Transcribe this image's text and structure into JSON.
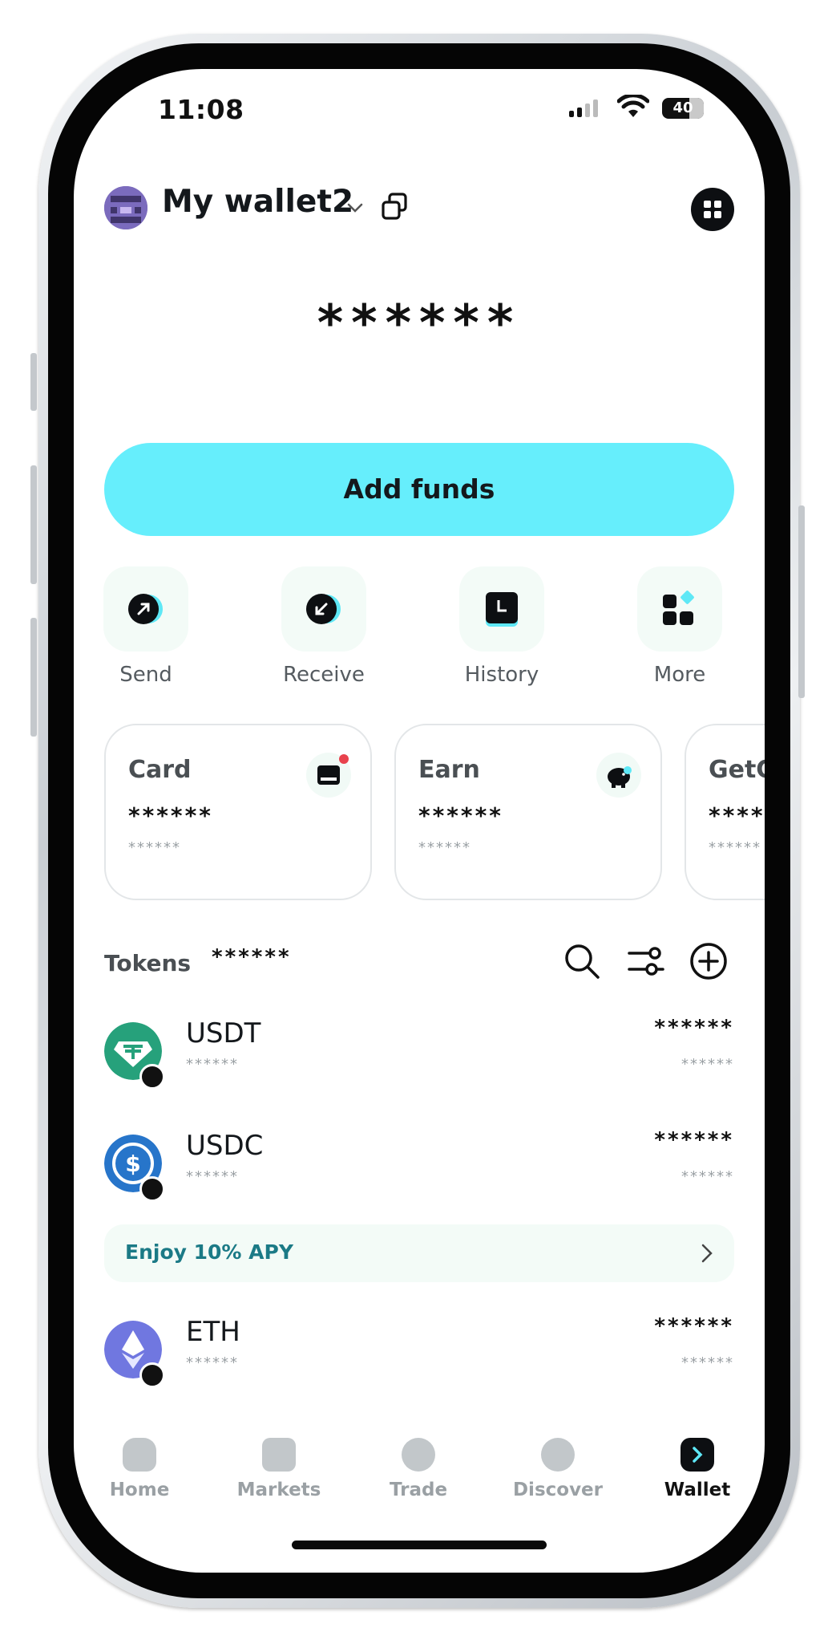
{
  "status_bar": {
    "time": "11:08",
    "battery": "40"
  },
  "header": {
    "wallet_name": "My wallet2"
  },
  "balance": "******",
  "add_funds_label": "Add funds",
  "quick_actions": [
    {
      "label": "Send",
      "icon": "send-arrow-icon"
    },
    {
      "label": "Receive",
      "icon": "receive-arrow-icon"
    },
    {
      "label": "History",
      "icon": "history-clock-icon"
    },
    {
      "label": "More",
      "icon": "more-apps-icon"
    }
  ],
  "cards": [
    {
      "title": "Card",
      "value": "******",
      "sub": "******",
      "icon": "card-icon"
    },
    {
      "title": "Earn",
      "value": "******",
      "sub": "******",
      "icon": "piggy-bank-icon"
    },
    {
      "title": "GetGo",
      "value": "******",
      "sub": "******",
      "icon": "getgo-icon"
    }
  ],
  "tokens_header": {
    "label": "Tokens",
    "total": "******"
  },
  "tokens": [
    {
      "symbol": "USDT",
      "sub": "******",
      "value": "******",
      "value_sub": "******",
      "color": "#26a17b"
    },
    {
      "symbol": "USDC",
      "sub": "******",
      "value": "******",
      "value_sub": "******",
      "color": "#2775ca"
    },
    {
      "symbol": "ETH",
      "sub": "******",
      "value": "******",
      "value_sub": "******",
      "color": "#7077e0"
    }
  ],
  "apy_banner": "Enjoy 10% APY",
  "bottom_nav": [
    {
      "label": "Home",
      "icon": "home-icon",
      "active": false
    },
    {
      "label": "Markets",
      "icon": "markets-icon",
      "active": false
    },
    {
      "label": "Trade",
      "icon": "trade-icon",
      "active": false
    },
    {
      "label": "Discover",
      "icon": "discover-icon",
      "active": false
    },
    {
      "label": "Wallet",
      "icon": "wallet-icon",
      "active": true
    }
  ],
  "colors": {
    "accent": "#66eefc",
    "tile_bg": "#f3fbf7",
    "apy_text": "#1b7a86"
  }
}
